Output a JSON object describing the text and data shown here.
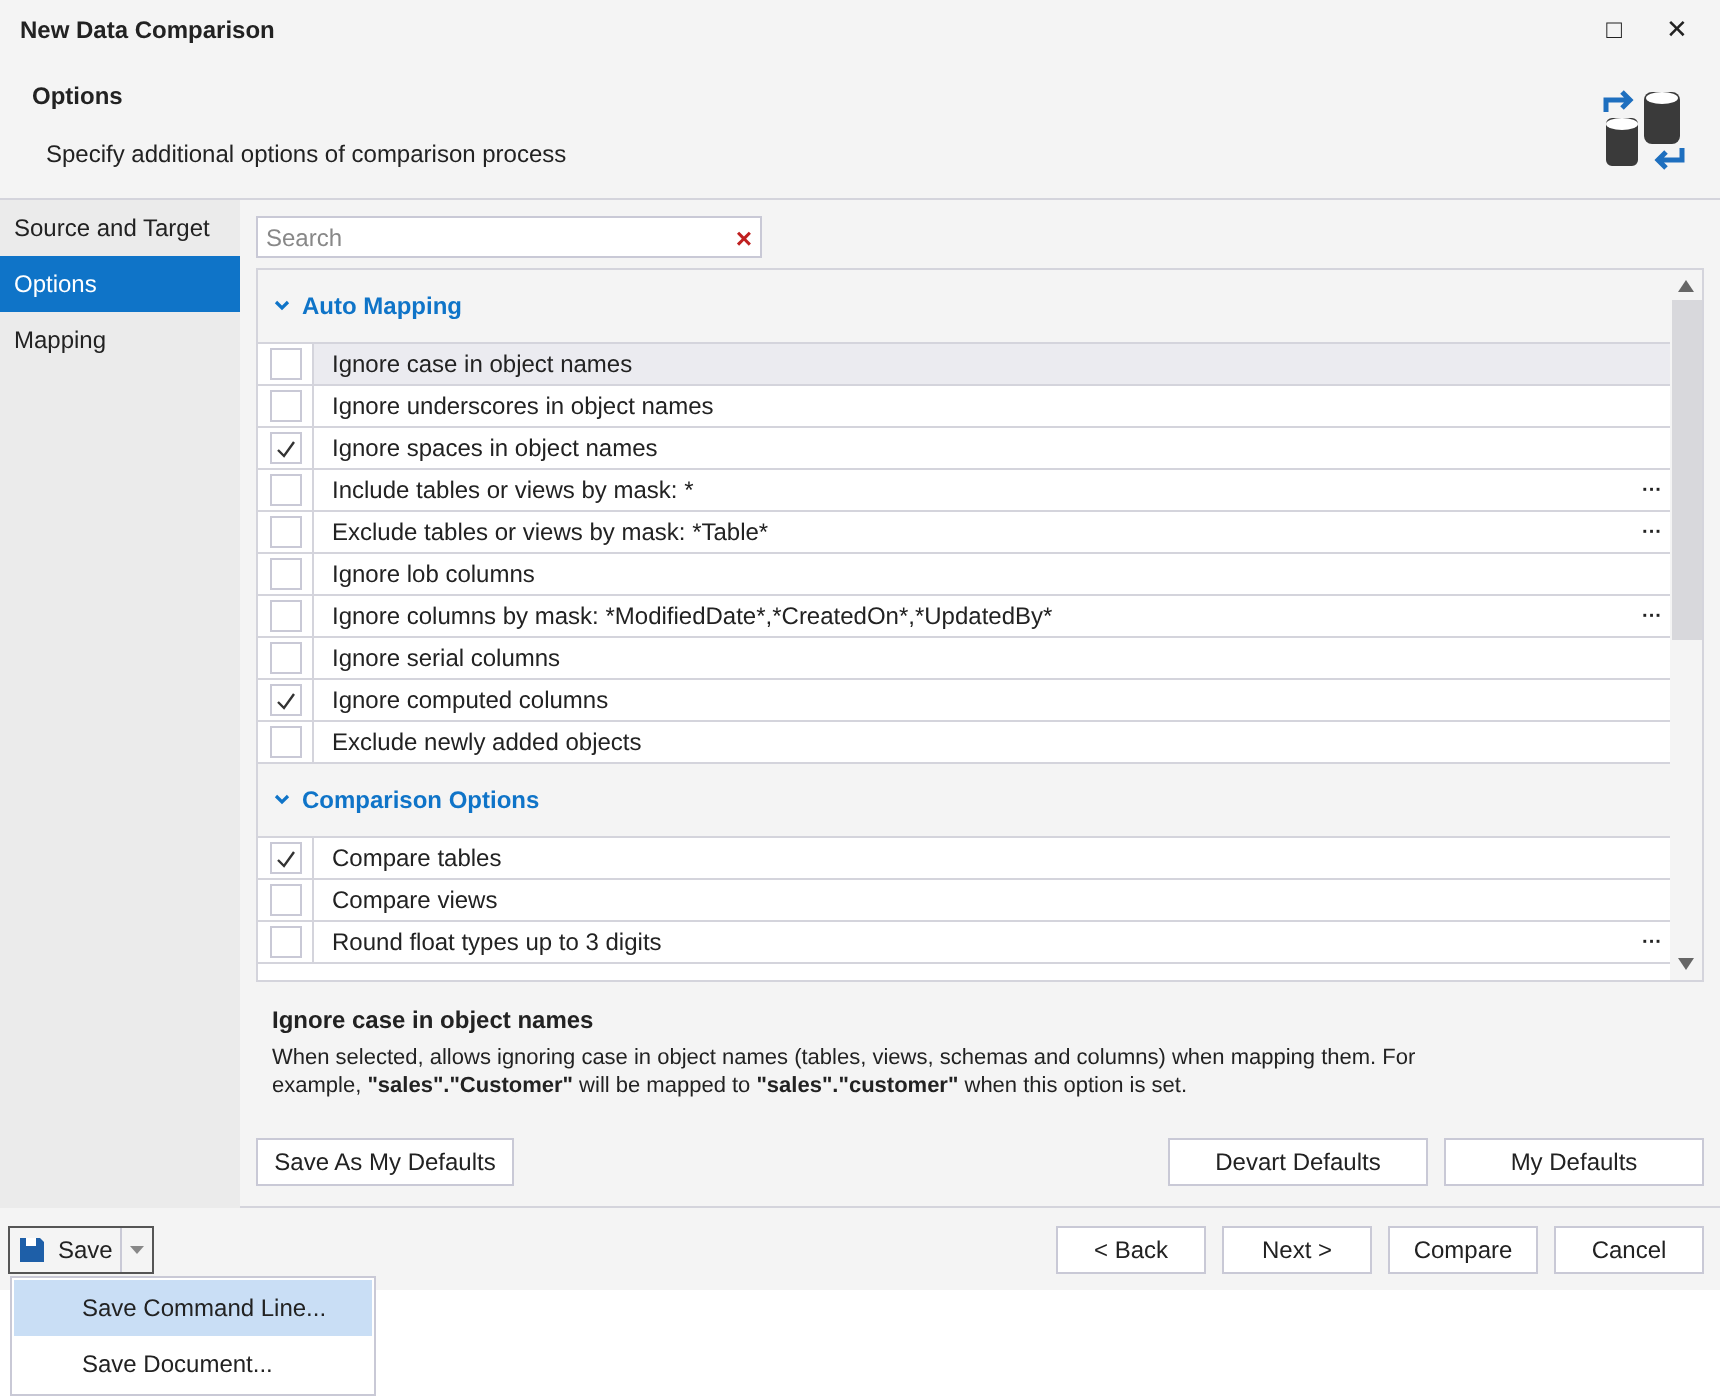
{
  "window": {
    "title": "New Data Comparison",
    "controls": [
      "□",
      "✕"
    ]
  },
  "header": {
    "title": "Options",
    "subtitle": "Specify additional options of comparison process"
  },
  "sidebar": {
    "items": [
      {
        "label": "Source and Target",
        "selected": false
      },
      {
        "label": "Options",
        "selected": true
      },
      {
        "label": "Mapping",
        "selected": false
      }
    ]
  },
  "search": {
    "placeholder": "Search",
    "clear": "×"
  },
  "groups": [
    {
      "title": "Auto Mapping",
      "expanded": true,
      "options": [
        {
          "label": "Ignore case in object names",
          "checked": false,
          "selected": true
        },
        {
          "label": "Ignore underscores in object names",
          "checked": false,
          "selected": false
        },
        {
          "label": "Ignore spaces in object names",
          "checked": true,
          "selected": false
        },
        {
          "label": "Include tables or views by mask: *",
          "checked": false,
          "selected": false,
          "action": "···"
        },
        {
          "label": "Exclude tables or views by mask: *Table*",
          "checked": false,
          "selected": false,
          "action": "···"
        },
        {
          "label": "Ignore lob columns",
          "checked": false,
          "selected": false
        },
        {
          "label": "Ignore columns by mask: *ModifiedDate*,*CreatedOn*,*UpdatedBy*",
          "checked": false,
          "selected": false,
          "action": "···"
        },
        {
          "label": "Ignore serial columns",
          "checked": false,
          "selected": false
        },
        {
          "label": "Ignore computed columns",
          "checked": true,
          "selected": false
        },
        {
          "label": "Exclude newly added objects",
          "checked": false,
          "selected": false
        }
      ]
    },
    {
      "title": "Comparison Options",
      "expanded": true,
      "options": [
        {
          "label": "Compare tables",
          "checked": true,
          "selected": false
        },
        {
          "label": "Compare views",
          "checked": false,
          "selected": false
        },
        {
          "label": "Round float types up to 3 digits",
          "checked": false,
          "selected": false,
          "action": "···"
        }
      ]
    }
  ],
  "description": {
    "title": "Ignore case in object names",
    "text": "When selected, allows ignoring case in object names (tables, views, schemas and columns) when mapping them. For example, **\"sales\".\"Customer\"** will be mapped to **\"sales\".\"customer\"** when this option is set."
  },
  "defaults_buttons": [
    "Save As My Defaults",
    "Devart Defaults",
    "My Defaults"
  ],
  "footer": {
    "save": "Save",
    "buttons": [
      "< Back",
      "Next >",
      "Compare",
      "Cancel"
    ]
  },
  "save_menu": {
    "items": [
      {
        "label": "Save Command Line...",
        "selected": true
      },
      {
        "label": "Save Document...",
        "selected": false
      }
    ]
  }
}
